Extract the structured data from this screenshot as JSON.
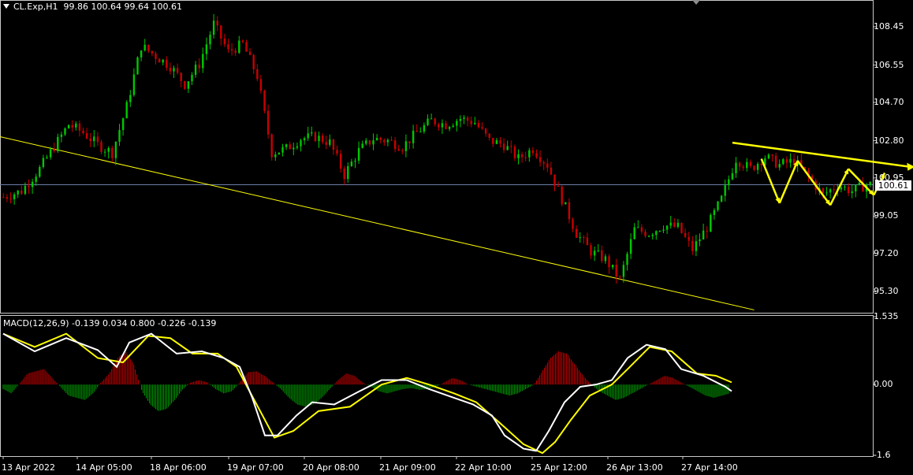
{
  "header": {
    "symbol": "CL.Exp,H1",
    "ohlc": "99.86 100.64 99.64 100.61"
  },
  "macd": {
    "label": "MACD(12,26,9) -0.139 0.034 0.800 -0.226 -0.139"
  },
  "chart_data": [
    {
      "type": "candlestick",
      "title": "CL.Exp,H1",
      "ylim": [
        94.3,
        109.7
      ],
      "y_ticks": [
        "108.45",
        "106.55",
        "104.70",
        "102.80",
        "100.95",
        "99.05",
        "97.20",
        "95.30"
      ],
      "current_price": "100.61",
      "x_ticks": [
        "13 Apr 2022",
        "14 Apr 05:00",
        "18 Apr 06:00",
        "19 Apr 07:00",
        "20 Apr 08:00",
        "21 Apr 09:00",
        "22 Apr 10:00",
        "25 Apr 12:00",
        "26 Apr 13:00",
        "27 Apr 14:00"
      ],
      "close_path": [
        [
          0,
          100.0
        ],
        [
          5,
          100.3
        ],
        [
          10,
          101.4
        ],
        [
          14,
          102.5
        ],
        [
          18,
          103.6
        ],
        [
          22,
          103.2
        ],
        [
          26,
          102.6
        ],
        [
          30,
          102.2
        ],
        [
          34,
          104.5
        ],
        [
          38,
          107.5
        ],
        [
          42,
          107.0
        ],
        [
          46,
          106.5
        ],
        [
          50,
          105.6
        ],
        [
          54,
          106.6
        ],
        [
          58,
          108.6
        ],
        [
          62,
          107.2
        ],
        [
          66,
          107.6
        ],
        [
          70,
          106.0
        ],
        [
          74,
          102.2
        ],
        [
          78,
          102.4
        ],
        [
          82,
          102.9
        ],
        [
          86,
          103.0
        ],
        [
          90,
          102.7
        ],
        [
          94,
          101.1
        ],
        [
          98,
          102.3
        ],
        [
          102,
          102.9
        ],
        [
          106,
          102.8
        ],
        [
          110,
          102.5
        ],
        [
          114,
          103.2
        ],
        [
          118,
          103.8
        ],
        [
          122,
          103.6
        ],
        [
          126,
          103.9
        ],
        [
          130,
          103.7
        ],
        [
          134,
          102.8
        ],
        [
          138,
          102.6
        ],
        [
          142,
          101.9
        ],
        [
          146,
          102.4
        ],
        [
          150,
          101.6
        ],
        [
          154,
          99.9
        ],
        [
          158,
          98.2
        ],
        [
          162,
          97.3
        ],
        [
          166,
          96.9
        ],
        [
          170,
          95.9
        ],
        [
          174,
          98.4
        ],
        [
          178,
          98.2
        ],
        [
          182,
          98.6
        ],
        [
          186,
          98.5
        ],
        [
          190,
          97.4
        ],
        [
          194,
          98.5
        ],
        [
          198,
          99.9
        ],
        [
          202,
          101.9
        ],
        [
          206,
          101.4
        ],
        [
          210,
          102.0
        ],
        [
          214,
          101.6
        ],
        [
          218,
          101.8
        ],
        [
          222,
          101.0
        ],
        [
          226,
          100.1
        ],
        [
          230,
          100.6
        ],
        [
          234,
          100.3
        ],
        [
          238,
          100.61
        ]
      ],
      "trendlines": [
        {
          "name": "support",
          "color": "#ffff00",
          "from": [
            -1,
            103.0
          ],
          "to": [
            207,
            94.4
          ]
        },
        {
          "name": "resistance",
          "color": "#ffff00",
          "from": [
            201,
            102.7
          ],
          "to": [
            250,
            101.5
          ]
        }
      ],
      "hline": {
        "value": 100.61,
        "color": "#6a7fa8"
      },
      "projection": [
        [
          209,
          101.9
        ],
        [
          214,
          99.7
        ],
        [
          219,
          101.8
        ],
        [
          228,
          99.6
        ],
        [
          233,
          101.4
        ],
        [
          240,
          100.1
        ],
        [
          243,
          101.2
        ]
      ],
      "colors": {
        "up": "#00c800",
        "down": "#c80000",
        "projection": "#ffff00"
      }
    },
    {
      "type": "line",
      "title": "MACD(12,26,9)",
      "ylim": [
        -1.6,
        1.535
      ],
      "y_ticks": [
        "1.535",
        "0.00",
        "-1.6"
      ],
      "series": [
        {
          "name": "histogram",
          "values": [
            -0.1,
            -0.2,
            0.02,
            0.25,
            0.3,
            0.35,
            0.15,
            -0.05,
            -0.25,
            -0.3,
            -0.35,
            -0.2,
            0.05,
            0.25,
            0.6,
            0.75,
            0.45,
            -0.15,
            -0.45,
            -0.6,
            -0.55,
            -0.35,
            -0.1,
            0.05,
            0.1,
            0.05,
            -0.1,
            -0.2,
            -0.15,
            0.05,
            0.28,
            0.3,
            0.2,
            0.05,
            -0.1,
            -0.3,
            -0.45,
            -0.5,
            -0.45,
            -0.3,
            -0.1,
            0.1,
            0.25,
            0.2,
            0.05,
            -0.05,
            -0.15,
            -0.2,
            -0.15,
            -0.1,
            -0.08,
            -0.12,
            -0.1,
            -0.05,
            0.05,
            0.15,
            0.1,
            0.0,
            -0.05,
            -0.1,
            -0.15,
            -0.2,
            -0.25,
            -0.2,
            -0.1,
            0.0,
            0.3,
            0.6,
            0.75,
            0.7,
            0.45,
            0.2,
            0.0,
            -0.15,
            -0.25,
            -0.35,
            -0.3,
            -0.2,
            -0.1,
            0.0,
            0.1,
            0.2,
            0.15,
            0.05,
            -0.05,
            -0.15,
            -0.25,
            -0.3,
            -0.25,
            -0.2
          ]
        },
        {
          "name": "macd",
          "color": "#ffffff",
          "values": [
            [
              0,
              1.15
            ],
            [
              20,
              0.75
            ],
            [
              40,
              1.05
            ],
            [
              60,
              0.78
            ],
            [
              72,
              0.4
            ],
            [
              80,
              0.95
            ],
            [
              94,
              1.15
            ],
            [
              110,
              0.7
            ],
            [
              126,
              0.75
            ],
            [
              140,
              0.6
            ],
            [
              150,
              0.4
            ],
            [
              158,
              -0.3
            ],
            [
              166,
              -1.15
            ],
            [
              174,
              -1.15
            ],
            [
              186,
              -0.7
            ],
            [
              196,
              -0.4
            ],
            [
              210,
              -0.45
            ],
            [
              226,
              -0.15
            ],
            [
              240,
              0.1
            ],
            [
              256,
              0.1
            ],
            [
              270,
              -0.1
            ],
            [
              286,
              -0.3
            ],
            [
              298,
              -0.45
            ],
            [
              310,
              -0.7
            ],
            [
              318,
              -1.15
            ],
            [
              330,
              -1.45
            ],
            [
              338,
              -1.5
            ],
            [
              346,
              -1.05
            ],
            [
              356,
              -0.4
            ],
            [
              366,
              -0.05
            ],
            [
              376,
              0.0
            ],
            [
              386,
              0.1
            ],
            [
              396,
              0.6
            ],
            [
              408,
              0.9
            ],
            [
              420,
              0.8
            ],
            [
              430,
              0.35
            ],
            [
              444,
              0.2
            ],
            [
              458,
              -0.05
            ],
            [
              462,
              -0.15
            ]
          ]
        },
        {
          "name": "signal",
          "color": "#ffff00",
          "values": [
            [
              0,
              1.15
            ],
            [
              20,
              0.85
            ],
            [
              40,
              1.15
            ],
            [
              60,
              0.6
            ],
            [
              76,
              0.5
            ],
            [
              92,
              1.1
            ],
            [
              106,
              1.05
            ],
            [
              120,
              0.7
            ],
            [
              136,
              0.7
            ],
            [
              148,
              0.4
            ],
            [
              160,
              -0.4
            ],
            [
              172,
              -1.2
            ],
            [
              184,
              -1.05
            ],
            [
              200,
              -0.6
            ],
            [
              220,
              -0.5
            ],
            [
              240,
              0.0
            ],
            [
              256,
              0.15
            ],
            [
              270,
              0.0
            ],
            [
              286,
              -0.2
            ],
            [
              300,
              -0.4
            ],
            [
              316,
              -0.9
            ],
            [
              330,
              -1.35
            ],
            [
              342,
              -1.55
            ],
            [
              350,
              -1.3
            ],
            [
              360,
              -0.8
            ],
            [
              372,
              -0.25
            ],
            [
              386,
              0.0
            ],
            [
              396,
              0.35
            ],
            [
              410,
              0.85
            ],
            [
              424,
              0.75
            ],
            [
              440,
              0.25
            ],
            [
              452,
              0.2
            ],
            [
              462,
              0.05
            ]
          ]
        }
      ]
    }
  ]
}
